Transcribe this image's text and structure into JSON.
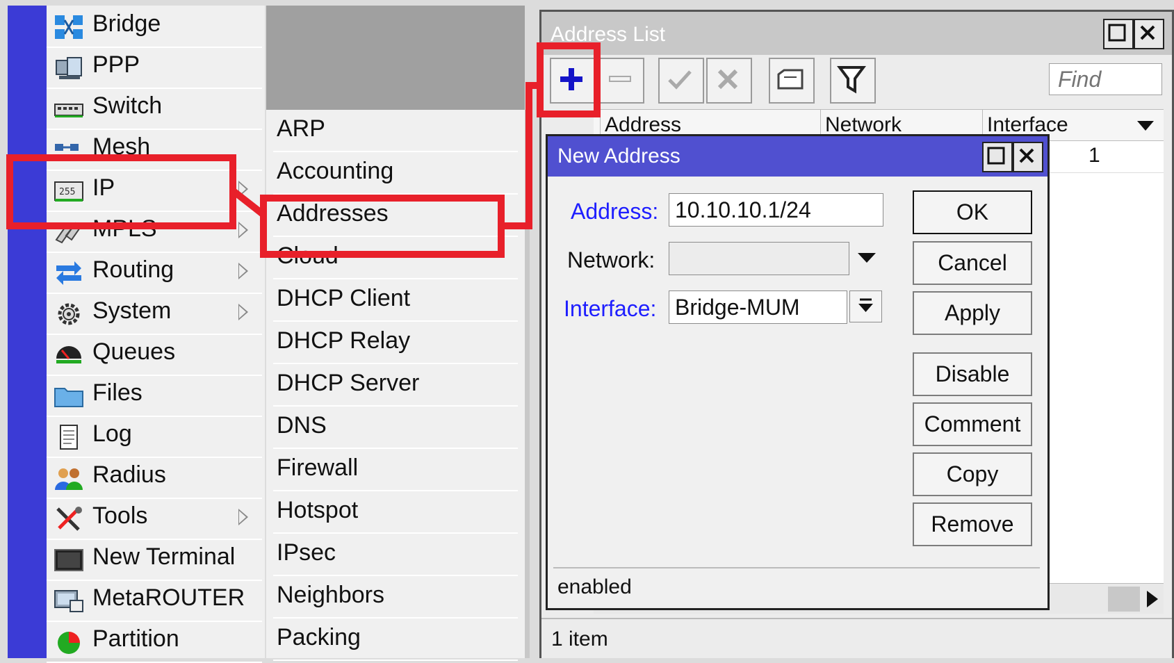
{
  "main_menu": {
    "items": [
      {
        "label": "Bridge",
        "icon": "bridge-icon",
        "submenu": false
      },
      {
        "label": "PPP",
        "icon": "ppp-icon",
        "submenu": false
      },
      {
        "label": "Switch",
        "icon": "switch-icon",
        "submenu": false
      },
      {
        "label": "Mesh",
        "icon": "mesh-icon",
        "submenu": false
      },
      {
        "label": "IP",
        "icon": "ip-icon",
        "submenu": true
      },
      {
        "label": "MPLS",
        "icon": "mpls-icon",
        "submenu": true
      },
      {
        "label": "Routing",
        "icon": "routing-icon",
        "submenu": true
      },
      {
        "label": "System",
        "icon": "gear-icon",
        "submenu": true
      },
      {
        "label": "Queues",
        "icon": "queues-icon",
        "submenu": false
      },
      {
        "label": "Files",
        "icon": "folder-icon",
        "submenu": false
      },
      {
        "label": "Log",
        "icon": "log-icon",
        "submenu": false
      },
      {
        "label": "Radius",
        "icon": "users-icon",
        "submenu": false
      },
      {
        "label": "Tools",
        "icon": "tools-icon",
        "submenu": true
      },
      {
        "label": "New Terminal",
        "icon": "terminal-icon",
        "submenu": false
      },
      {
        "label": "MetaROUTER",
        "icon": "metarouter-icon",
        "submenu": false
      },
      {
        "label": "Partition",
        "icon": "partition-icon",
        "submenu": false
      }
    ]
  },
  "ip_submenu": {
    "items": [
      "ARP",
      "Accounting",
      "Addresses",
      "Cloud",
      "DHCP Client",
      "DHCP Relay",
      "DHCP Server",
      "DNS",
      "Firewall",
      "Hotspot",
      "IPsec",
      "Neighbors",
      "Packing"
    ]
  },
  "address_list": {
    "title": "Address List",
    "find_placeholder": "Find",
    "columns": [
      "Address",
      "Network",
      "Interface"
    ],
    "row_fragment": "1",
    "status": "1 item",
    "toolbar": [
      "add-icon",
      "remove-icon",
      "enable-icon",
      "disable-icon",
      "comment-icon",
      "filter-icon"
    ]
  },
  "new_address": {
    "title": "New Address",
    "address_label": "Address:",
    "address_value": "10.10.10.1/24",
    "network_label": "Network:",
    "network_value": "",
    "interface_label": "Interface:",
    "interface_value": "Bridge-MUM",
    "buttons": {
      "ok": "OK",
      "cancel": "Cancel",
      "apply": "Apply",
      "disable": "Disable",
      "comment": "Comment",
      "copy": "Copy",
      "remove": "Remove"
    },
    "status": "enabled"
  },
  "colors": {
    "sidebar_strip": "#3b3bd6",
    "dialog_title": "#5050d0",
    "field_label_link": "#1e1eff",
    "highlight": "#e8202a"
  }
}
